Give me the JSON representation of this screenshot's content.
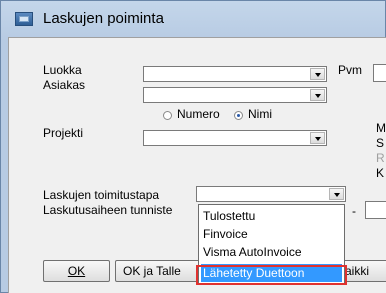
{
  "window": {
    "title": "Laskujen poiminta"
  },
  "form": {
    "luokka_label": "Luokka",
    "asiakas_label": "Asiakas",
    "projekti_label": "Projekti",
    "pvm_label": "Pvm",
    "radio_numero_label": "Numero",
    "radio_nimi_label": "Nimi",
    "radio_selected": "Nimi",
    "toimitustapa_label": "Laskujen toimitustapa",
    "tunniste_label": "Laskutusaiheen tunniste",
    "dash_label": "-",
    "right_labels": [
      "M",
      "S",
      "R",
      "K"
    ]
  },
  "dropdown": {
    "options": [
      "Tulostettu",
      "Finvoice",
      "Visma AutoInvoice",
      "Lähetetty Duettoon"
    ],
    "highlighted": "Lähetetty Duettoon"
  },
  "buttons": {
    "ok_label": "OK",
    "ok_tallenna_label": "OK ja Talle",
    "kaikki_label": "aikki"
  },
  "colors": {
    "highlight": "#3399ff",
    "annotation_box": "#e0312f"
  }
}
